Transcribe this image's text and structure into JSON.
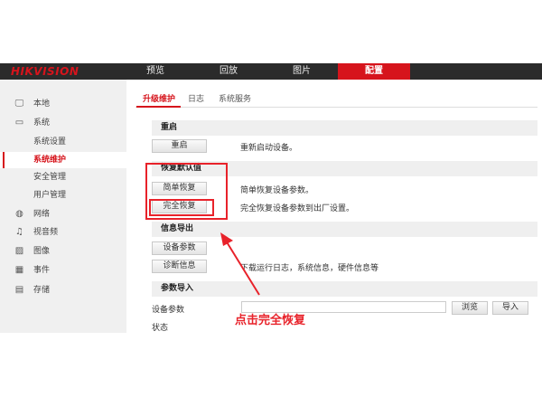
{
  "header": {
    "logo": "HIKVISION",
    "tabs": [
      {
        "label": "预览"
      },
      {
        "label": "回放"
      },
      {
        "label": "图片"
      },
      {
        "label": "配置",
        "active": true
      }
    ]
  },
  "sidebar": {
    "items": [
      {
        "label": "本地",
        "icon": "monitor-icon"
      },
      {
        "label": "系统",
        "icon": "window-icon"
      },
      {
        "label": "系统设置"
      },
      {
        "label": "系统维护",
        "active": true
      },
      {
        "label": "安全管理"
      },
      {
        "label": "用户管理"
      },
      {
        "label": "网络",
        "icon": "globe-icon"
      },
      {
        "label": "视音频",
        "icon": "mic-icon"
      },
      {
        "label": "图像",
        "icon": "image-icon"
      },
      {
        "label": "事件",
        "icon": "calendar-icon"
      },
      {
        "label": "存储",
        "icon": "storage-icon"
      }
    ]
  },
  "main": {
    "tabs": [
      {
        "label": "升级维护",
        "active": true
      },
      {
        "label": "日志"
      },
      {
        "label": "系统服务"
      }
    ],
    "reboot": {
      "title": "重启",
      "button": "重启",
      "desc": "重新启动设备。"
    },
    "restore": {
      "title": "恢复默认值",
      "simple_button": "简单恢复",
      "simple_desc": "简单恢复设备参数。",
      "full_button": "完全恢复",
      "full_desc": "完全恢复设备参数到出厂设置。"
    },
    "export": {
      "title": "信息导出",
      "params_button": "设备参数",
      "diag_button": "诊断信息",
      "diag_desc": "下载运行日志，系统信息，硬件信息等"
    },
    "import": {
      "title": "参数导入",
      "field_label": "设备参数",
      "field_value": "",
      "browse_button": "浏览",
      "import_button": "导入",
      "status_label": "状态"
    }
  },
  "annotation": {
    "text": "点击完全恢复",
    "color": "#e8222a"
  },
  "colors": {
    "accent": "#d6141c",
    "topbar": "#2b2b2b"
  }
}
